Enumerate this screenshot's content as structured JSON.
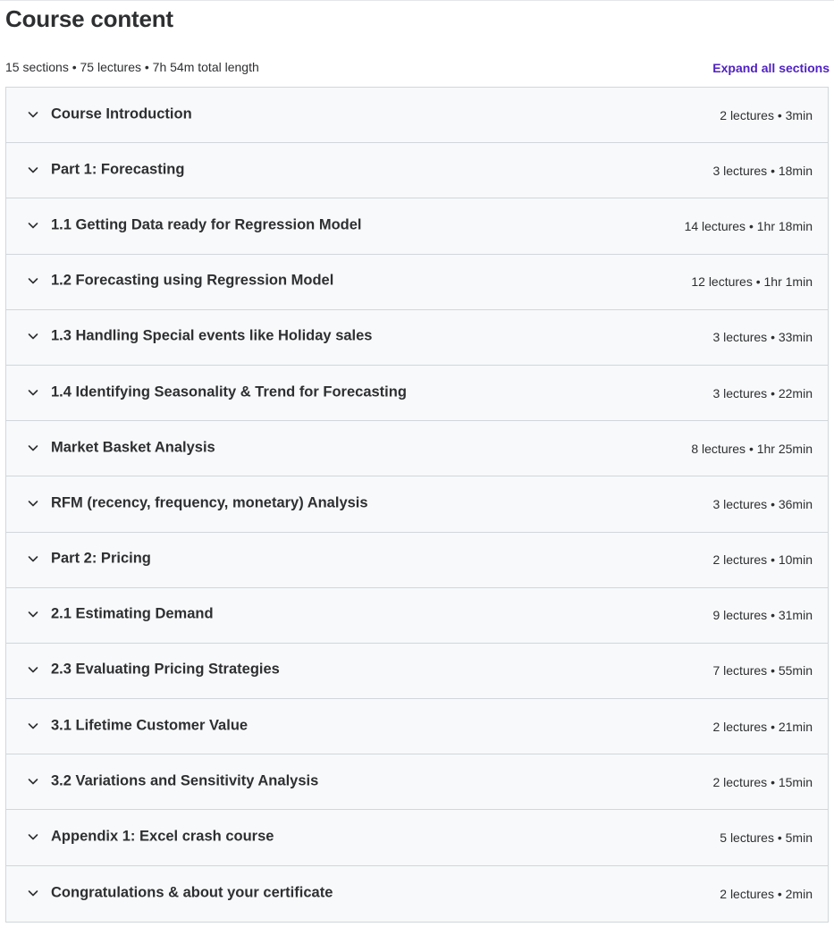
{
  "header": {
    "title": "Course content",
    "summary": "15 sections • 75 lectures • 7h 54m total length",
    "expand_all_label": "Expand all sections"
  },
  "colors": {
    "accent": "#5022c3",
    "row_background": "#f7f9fa",
    "border": "#d1d7dc",
    "text": "#2d2f31"
  },
  "icons": {
    "section_toggle": "chevron-down-icon"
  },
  "sections": [
    {
      "title": "Course Introduction",
      "meta": "2 lectures • 3min"
    },
    {
      "title": "Part 1: Forecasting",
      "meta": "3 lectures • 18min"
    },
    {
      "title": "1.1 Getting Data ready for Regression Model",
      "meta": "14 lectures • 1hr 18min"
    },
    {
      "title": "1.2 Forecasting using Regression Model",
      "meta": "12 lectures • 1hr 1min"
    },
    {
      "title": "1.3 Handling Special events like Holiday sales",
      "meta": "3 lectures • 33min"
    },
    {
      "title": "1.4 Identifying Seasonality & Trend for Forecasting",
      "meta": "3 lectures • 22min"
    },
    {
      "title": "Market Basket Analysis",
      "meta": "8 lectures • 1hr 25min"
    },
    {
      "title": "RFM (recency, frequency, monetary) Analysis",
      "meta": "3 lectures • 36min"
    },
    {
      "title": "Part 2: Pricing",
      "meta": "2 lectures • 10min"
    },
    {
      "title": "2.1 Estimating Demand",
      "meta": "9 lectures • 31min"
    },
    {
      "title": "2.3 Evaluating Pricing Strategies",
      "meta": "7 lectures • 55min"
    },
    {
      "title": "3.1 Lifetime Customer Value",
      "meta": "2 lectures • 21min"
    },
    {
      "title": "3.2 Variations and Sensitivity Analysis",
      "meta": "2 lectures • 15min"
    },
    {
      "title": "Appendix 1: Excel crash course",
      "meta": "5 lectures • 5min"
    },
    {
      "title": "Congratulations & about your certificate",
      "meta": "2 lectures • 2min"
    }
  ]
}
